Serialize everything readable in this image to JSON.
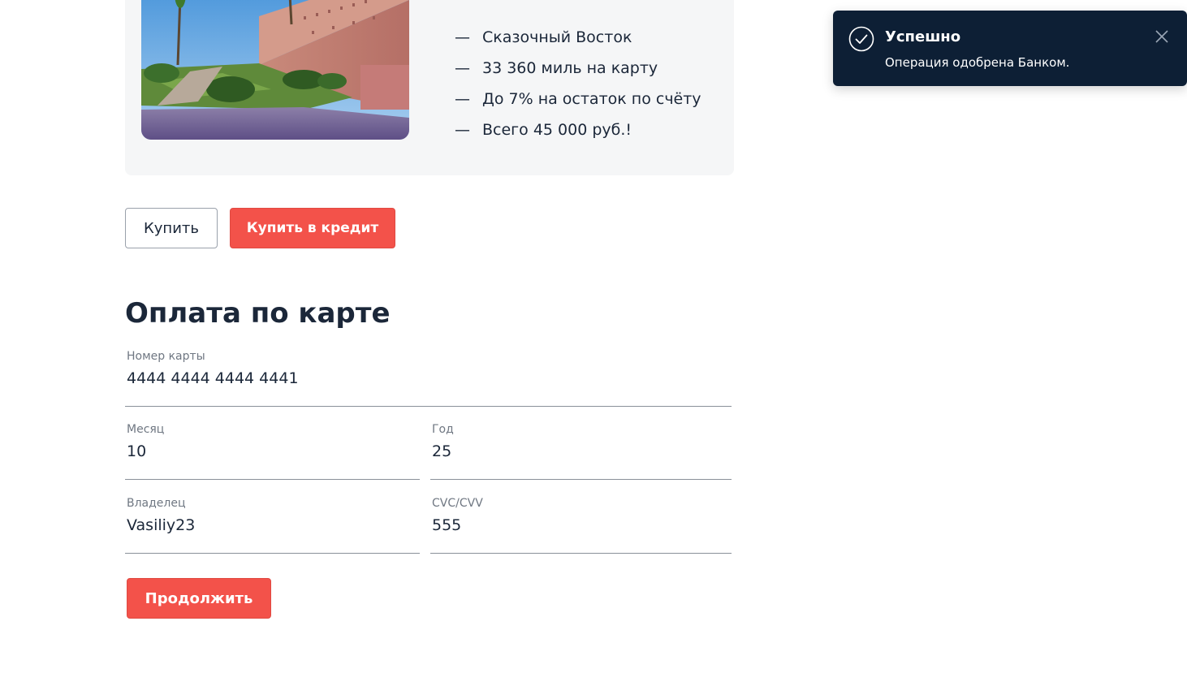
{
  "offer": {
    "image_alt": "Marrakech city wall with palm trees",
    "features": [
      {
        "dash": "—",
        "text": "Сказочный Восток"
      },
      {
        "dash": "—",
        "text": "33 360 миль на карту"
      },
      {
        "dash": "—",
        "text": "До 7% на остаток по счёту"
      },
      {
        "dash": "—",
        "text": "Всего 45 000 руб.!"
      }
    ]
  },
  "buttons": {
    "buy_label": "Купить",
    "buy_credit_label": "Купить в кредит"
  },
  "payment": {
    "title": "Оплата по карте",
    "card_number": {
      "label": "Номер карты",
      "value": "4444 4444 4444 4441"
    },
    "month": {
      "label": "Месяц",
      "value": "10"
    },
    "year": {
      "label": "Год",
      "value": "25"
    },
    "owner": {
      "label": "Владелец",
      "value": "Vasiliy23"
    },
    "cvc": {
      "label": "CVC/CVV",
      "value": "555"
    },
    "continue_label": "Продолжить"
  },
  "notification": {
    "title": "Успешно",
    "message": "Операция одобрена Банком.",
    "status_icon": "check-circle-icon",
    "close_icon": "close-icon"
  },
  "colors": {
    "accent": "#f3524a",
    "toast_background": "#0d1f35",
    "text": "#1b2739",
    "card_background": "#f5f6f7"
  }
}
